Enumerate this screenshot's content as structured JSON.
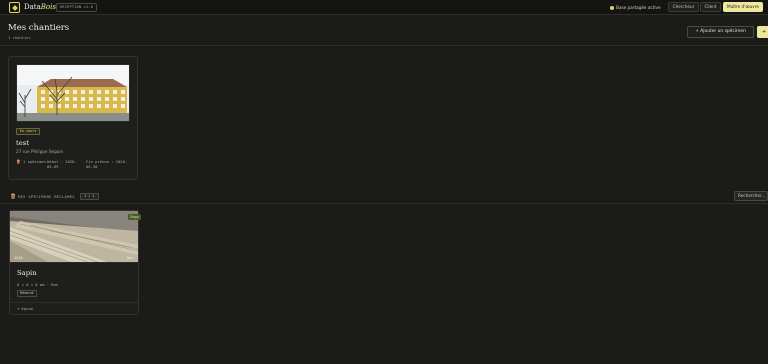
{
  "topbar": {
    "brand_prefix": "Data",
    "brand_suffix": "Bois",
    "version": "RÉCEPTION v1.0",
    "db_status": "Base partagée active",
    "roles": [
      "Chercheur",
      "Client",
      "Maître d'œuvre"
    ],
    "active_role_index": 2
  },
  "header": {
    "title": "Mes chantiers",
    "subtitle": "1 chantier",
    "add_button": "+ Ajouter un spécimen",
    "secondary_button": "+"
  },
  "chantier": {
    "status_badge": "En cours",
    "name": "test",
    "address": "27 rue Philippe Seguin",
    "specimens": "1 spécimen",
    "debut": "Début : 2026-05-09",
    "fin": "Fin prévue : 2026-06-30"
  },
  "specimens_section": {
    "label": "MES SPÉCIMENS RÉCLAMÉS",
    "count": "1 / 1",
    "search_placeholder": "Rechercher..."
  },
  "specimen": {
    "top_tag": "Dispo",
    "bottom_left": "1234",
    "bottom_right": "Bon",
    "name": "Sapin",
    "dims": "0 × 0 × 0 mm · Bon",
    "badge": "Réservé",
    "footer": "+ épinal"
  },
  "colors": {
    "accent": "#efe79c",
    "background": "#1b1b1a",
    "card": "#1e1e1c",
    "border": "#33332f"
  }
}
